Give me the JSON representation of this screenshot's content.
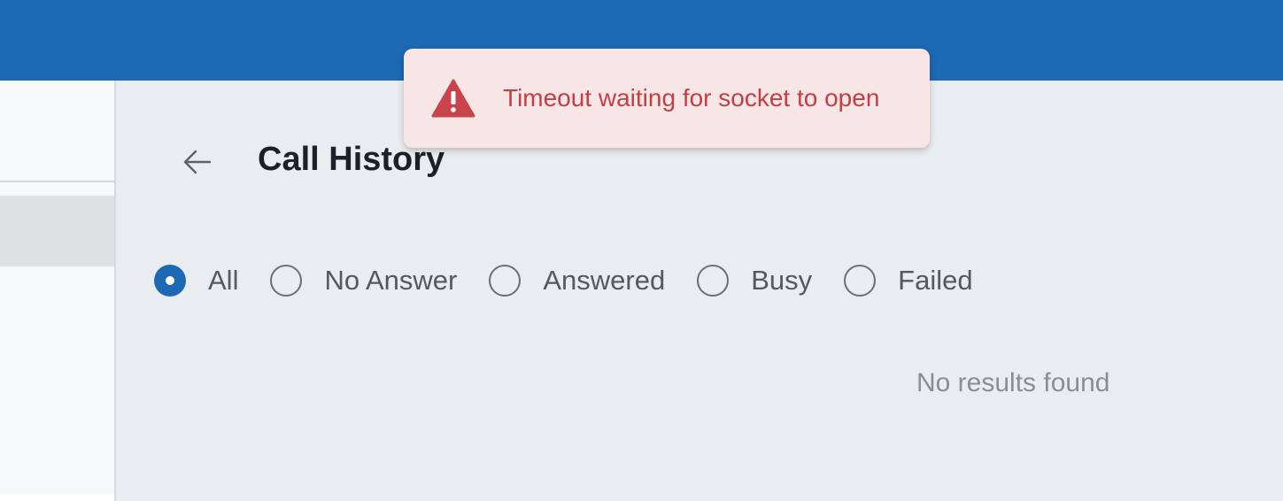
{
  "header": {
    "background_color": "#1c69b4"
  },
  "sidebar": {
    "selected_item_color": "#dfe0e2"
  },
  "page": {
    "title": "Call History",
    "back_icon": "arrow-left-icon"
  },
  "filters": {
    "options": [
      {
        "label": "All",
        "checked": true
      },
      {
        "label": "No Answer",
        "checked": false
      },
      {
        "label": "Answered",
        "checked": false
      },
      {
        "label": "Busy",
        "checked": false
      },
      {
        "label": "Failed",
        "checked": false
      }
    ],
    "accent_color": "#1c69b4"
  },
  "results": {
    "empty_message": "No results found"
  },
  "toast": {
    "message": "Timeout waiting for socket to open",
    "icon": "warning-icon",
    "text_color": "#c33e45",
    "background_color": "#f8e6e7"
  }
}
